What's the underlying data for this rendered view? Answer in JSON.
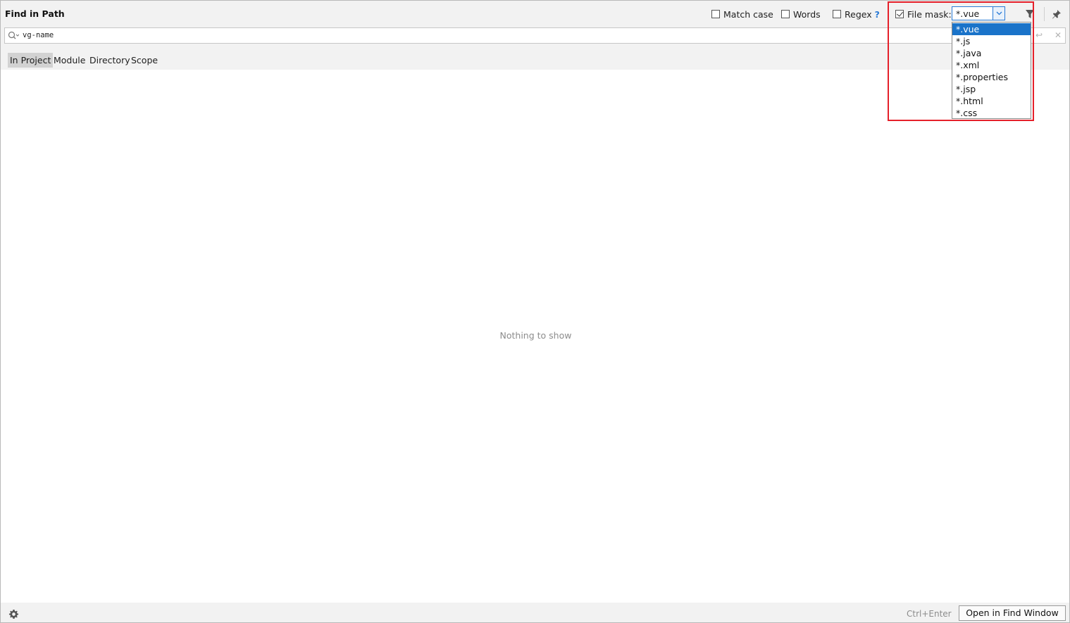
{
  "window": {
    "title": "Find in Path"
  },
  "options": {
    "match_case": {
      "label": "Match case",
      "checked": false
    },
    "words": {
      "label": "Words",
      "checked": false
    },
    "regex": {
      "label": "Regex",
      "checked": false,
      "help": "?"
    },
    "file_mask": {
      "label": "File mask:",
      "checked": true
    }
  },
  "file_mask_combo": {
    "value": "*.vue",
    "options": [
      "*.vue",
      "*.js",
      "*.java",
      "*.xml",
      "*.properties",
      "*.jsp",
      "*.html",
      "*.css"
    ],
    "selected_index": 0
  },
  "search": {
    "query": "vg-name"
  },
  "scope_tabs": [
    {
      "label": "In Project",
      "active": true
    },
    {
      "label": "Module",
      "active": false
    },
    {
      "label": "Directory",
      "active": false
    },
    {
      "label": "Scope",
      "active": false
    }
  ],
  "results": {
    "empty_text": "Nothing to show"
  },
  "footer": {
    "shortcut": "Ctrl+Enter",
    "open_button": "Open in Find Window"
  },
  "colors": {
    "accent": "#2a7bd6",
    "selection": "#1a73c9",
    "highlight_box": "#e5202a"
  }
}
